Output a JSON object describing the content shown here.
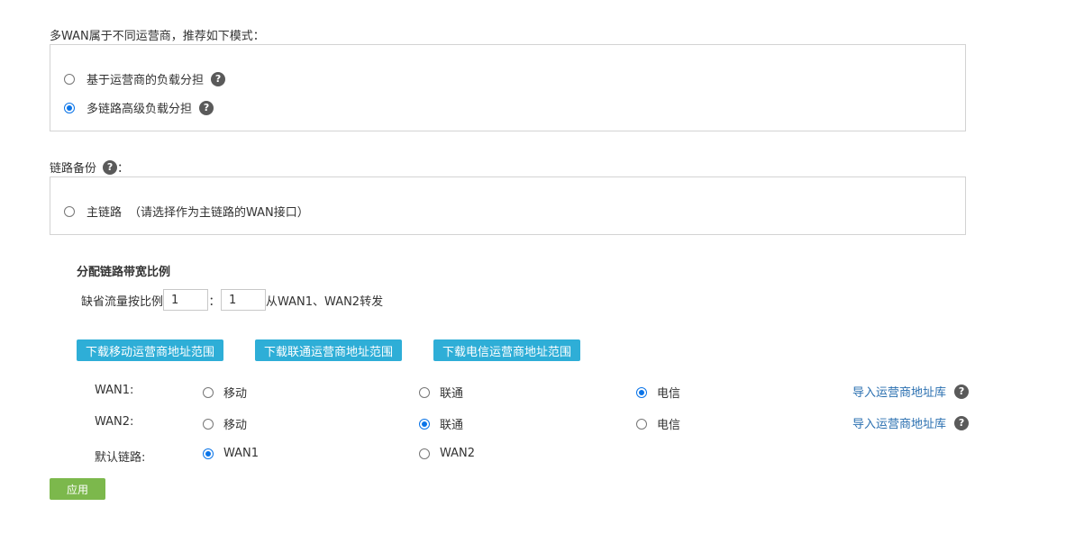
{
  "multiwan": {
    "title": "多WAN属于不同运营商，推荐如下模式：",
    "options": [
      {
        "label": "基于运营商的负载分担",
        "checked": false
      },
      {
        "label": "多链路高级负载分担",
        "checked": true
      }
    ]
  },
  "backup": {
    "title": "链路备份",
    "colon": "：",
    "option_label": "主链路",
    "option_hint": "（请选择作为主链路的WAN接口）"
  },
  "bandwidth": {
    "title": "分配链路带宽比例",
    "default_label": "缺省流量按比例",
    "ratio_left": "1",
    "ratio_sep": "：",
    "ratio_right": "1",
    "suffix": "从WAN1、WAN2转发"
  },
  "downloads": {
    "mobile": "下载移动运营商地址范围",
    "unicom": "下载联通运营商地址范围",
    "telecom": "下载电信运营商地址范围"
  },
  "isp_labels": {
    "mobile": "移动",
    "unicom": "联通",
    "telecom": "电信"
  },
  "wan1": {
    "label": "WAN1:",
    "selected": "电信",
    "import_link": "导入运营商地址库"
  },
  "wan2": {
    "label": "WAN2:",
    "selected": "联通",
    "import_link": "导入运营商地址库"
  },
  "default_link": {
    "label": "默认链路:",
    "options": [
      "WAN1",
      "WAN2"
    ],
    "selected": "WAN1"
  },
  "apply_label": "应用",
  "help_glyph": "?",
  "colors": {
    "accent": "#0a74e8",
    "download_button": "#2eaed7",
    "apply_button": "#7cb84c",
    "link": "#2a6fb0"
  }
}
